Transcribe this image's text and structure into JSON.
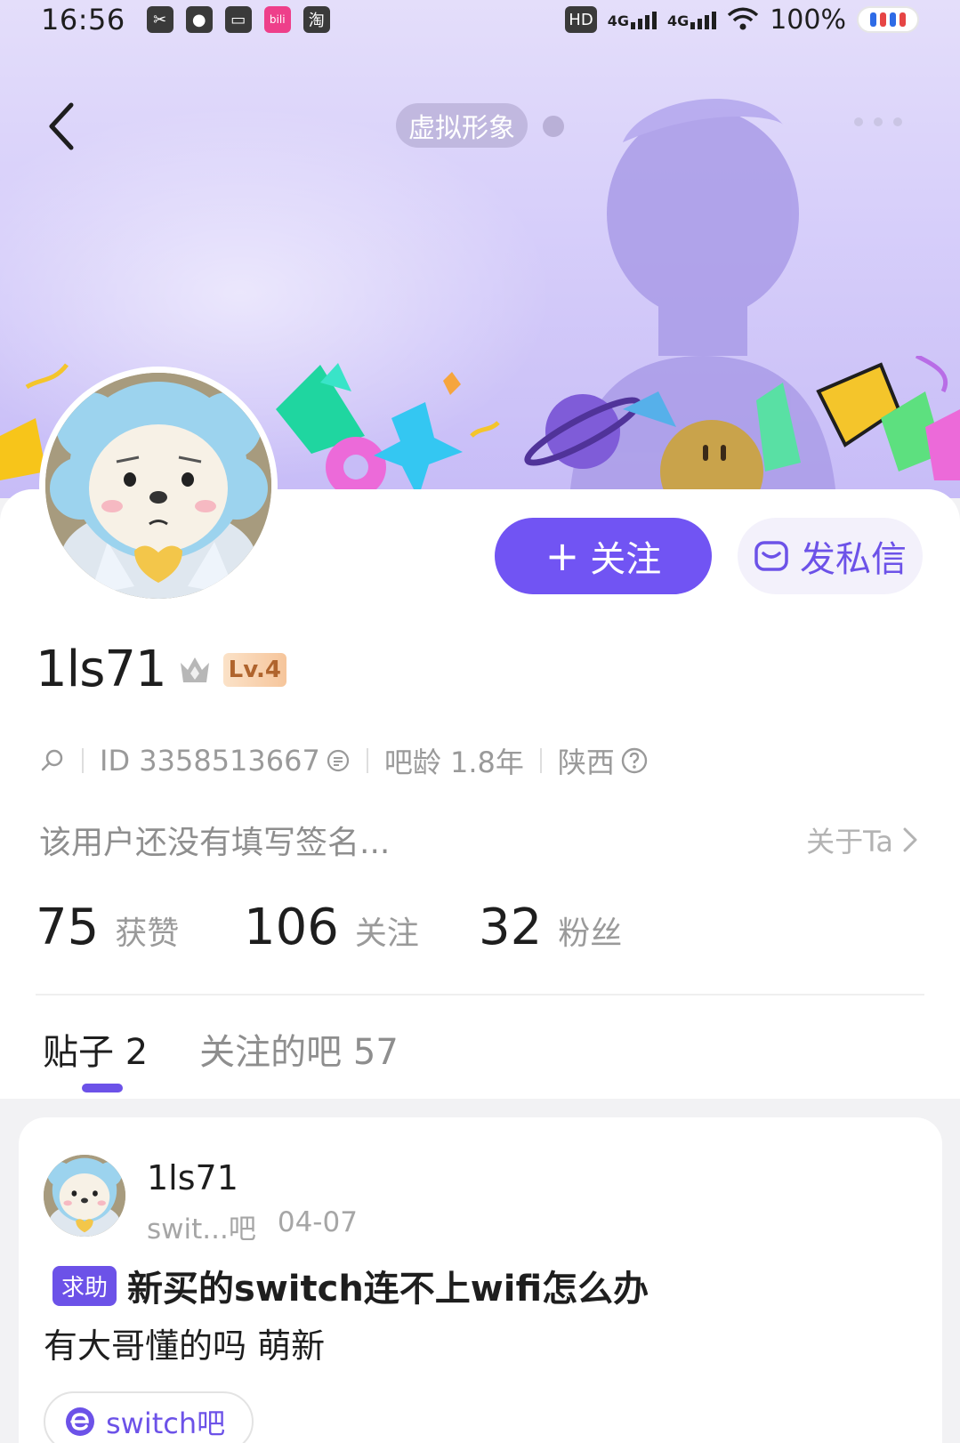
{
  "status_bar": {
    "time": "16:56",
    "app_icons": [
      {
        "name": "clipboard-app-icon",
        "glyph": "✂"
      },
      {
        "name": "wechat-app-icon",
        "glyph": "●"
      },
      {
        "name": "wallet-app-icon",
        "glyph": "▭"
      },
      {
        "name": "bilibili-app-icon",
        "glyph": "bili"
      },
      {
        "name": "taobao-app-icon",
        "glyph": "淘"
      }
    ],
    "hd_label": "HD",
    "network_label_1": "4G",
    "network_label_2": "4G",
    "battery_text": "100%"
  },
  "nav": {
    "back_icon": "chevron-left-icon",
    "virtual_avatar_label": "虚拟形象",
    "more_icon": "more-dots-icon"
  },
  "profile": {
    "follow_button_label": "关注",
    "follow_button_icon": "+",
    "message_button_label": "发私信",
    "username": "1ls71",
    "level_badge": "Lv.4",
    "id_text": "ID 3358513667",
    "bar_age_text": "吧龄 1.8年",
    "location_text": "陕西",
    "signature": "该用户还没有填写签名...",
    "about_label": "关于Ta",
    "stats": {
      "likes_value": "75",
      "likes_label": "获赞",
      "following_value": "106",
      "following_label": "关注",
      "fans_value": "32",
      "fans_label": "粉丝"
    }
  },
  "tabs": [
    {
      "label": "贴子 2",
      "active": true
    },
    {
      "label": "关注的吧 57",
      "active": false
    }
  ],
  "post": {
    "author": "1ls71",
    "forum_short": "swit...吧",
    "date": "04-07",
    "tag": "求助",
    "title": "新买的switch连不上wifi怎么办",
    "body": "有大哥懂的吗 萌新",
    "forum_pill": "switch吧"
  },
  "colors": {
    "accent": "#7154f3",
    "banner_top": "#e4defa",
    "banner_bottom": "#c7bcf7"
  }
}
